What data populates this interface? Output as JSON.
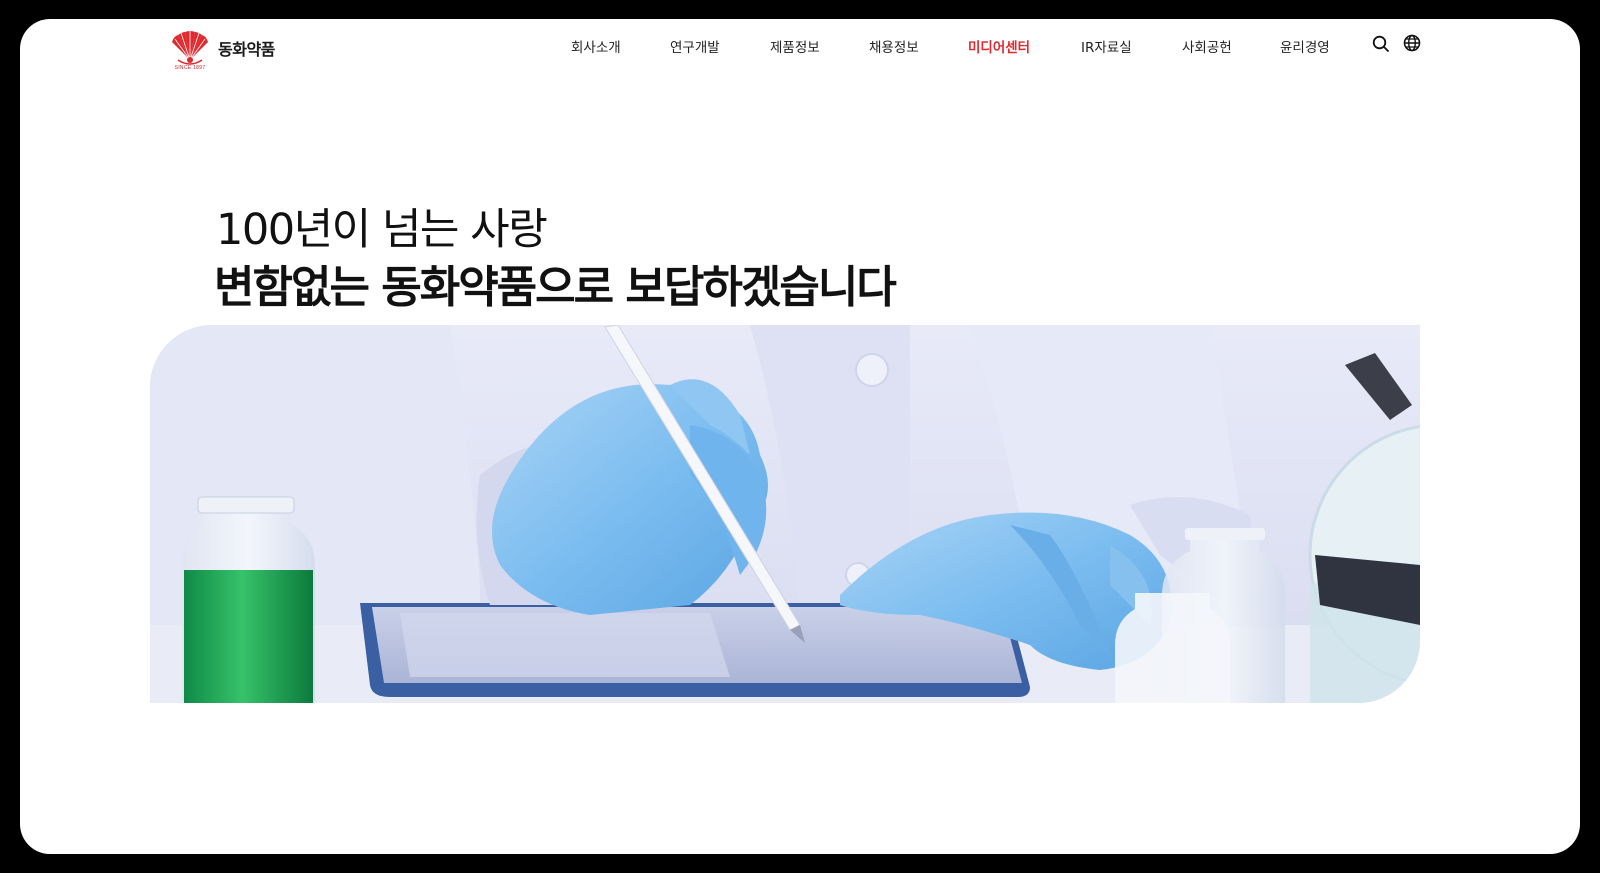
{
  "brand": {
    "name": "동화약품",
    "since": "SINCE 1897",
    "logo_icon": "fan-logo-icon",
    "brand_color": "#e0292f"
  },
  "nav": {
    "items": [
      {
        "label": "회사소개"
      },
      {
        "label": "연구개발"
      },
      {
        "label": "제품정보"
      },
      {
        "label": "채용정보"
      },
      {
        "label": "미디어센터",
        "active": true
      },
      {
        "label": "IR자료실"
      },
      {
        "label": "사회공헌"
      },
      {
        "label": "윤리경영"
      }
    ],
    "active_color": "#e0292f",
    "search_icon": "search-icon",
    "language_icon": "globe-icon"
  },
  "hero": {
    "line1": "100년이 넘는 사랑",
    "line2": "변함없는 동화약품으로 보답하겠습니다",
    "image": "lab-researcher-gloves-tablet-image"
  }
}
